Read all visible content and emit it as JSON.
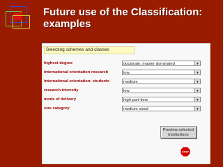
{
  "slide": {
    "title_line1": "Future use of the Classification:",
    "title_line2": "examples",
    "accent_color": "#9a1c00"
  },
  "panel": {
    "header": "Selecting schemes and classes",
    "rows": [
      {
        "label": "highest degree",
        "value": "doctorate, master dominated"
      },
      {
        "label": "international orientation research",
        "value": "low"
      },
      {
        "label": "international orientation; students",
        "value": "medium"
      },
      {
        "label": "research intensity",
        "value": "low"
      },
      {
        "label": "mode of delivery",
        "value": "high part-time"
      },
      {
        "label": "size category",
        "value": "medium sized"
      }
    ],
    "preview_button_line1": "Preview selected",
    "preview_button_line2": "institutions",
    "stop_icon": "stop-sign-icon",
    "stop_label": "STOP"
  }
}
